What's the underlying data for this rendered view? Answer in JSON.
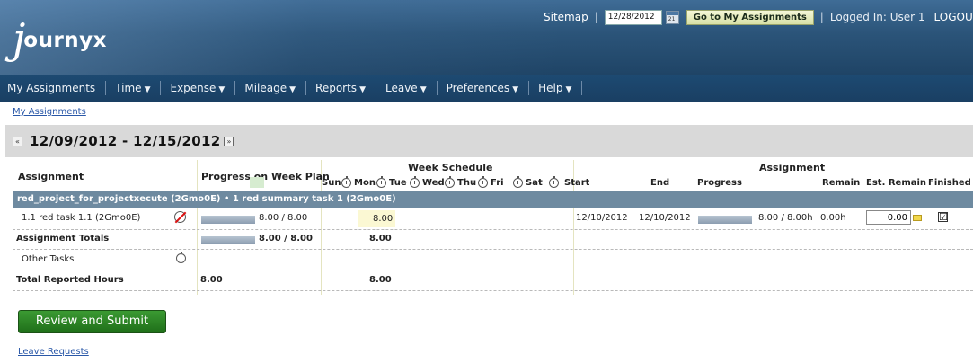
{
  "brand": {
    "logo_initial": "j",
    "logo_text": "ournyx"
  },
  "topbar": {
    "sitemap": "Sitemap",
    "date_value": "12/28/2012",
    "goto_label": "Go to My Assignments",
    "logged_in": "Logged In: User 1",
    "logout": "LOGOUT"
  },
  "nav": [
    {
      "label": "My Assignments",
      "arrow": ""
    },
    {
      "label": "Time",
      "arrow": "▼"
    },
    {
      "label": "Expense",
      "arrow": "▼"
    },
    {
      "label": "Mileage",
      "arrow": "▼"
    },
    {
      "label": "Reports",
      "arrow": "▼"
    },
    {
      "label": "Leave",
      "arrow": "▼"
    },
    {
      "label": "Preferences",
      "arrow": "▼"
    },
    {
      "label": "Help",
      "arrow": "▼"
    }
  ],
  "breadcrumb": "My Assignments",
  "week": {
    "prev": "«",
    "title": "12/09/2012 - 12/15/2012",
    "next": "»"
  },
  "table": {
    "headers": {
      "assignment": "Assignment",
      "progress_plan": "Progress on Week Plan",
      "week_schedule": "Week Schedule",
      "assignment_group": "Assignment",
      "days": [
        "Sun",
        "Mon",
        "Tue",
        "Wed",
        "Thu",
        "Fri",
        "Sat"
      ],
      "start": "Start",
      "end": "End",
      "progress": "Progress",
      "remain": "Remain",
      "est_remain": "Est. Remain",
      "finished": "Finished"
    },
    "project_row": "red_project_for_projectxecute (2Gmo0E) • 1 red summary task 1 (2Gmo0E)",
    "task_row": {
      "name": "1.1 red task 1.1 (2Gmo0E)",
      "plan_progress": 1.0,
      "plan_text": "8.00 / 8.00",
      "mon_hours": "8.00",
      "start": "12/10/2012",
      "end": "12/10/2012",
      "progress": 1.0,
      "progress_text": "8.00 / 8.00h",
      "remain": "0.00h",
      "est_remain": "0.00",
      "finished": "☑"
    },
    "totals_row": {
      "label": "Assignment Totals",
      "plan_progress": 1.0,
      "plan_text": "8.00 / 8.00",
      "hours": "8.00"
    },
    "other_row": {
      "label": "Other Tasks"
    },
    "reported_row": {
      "label": "Total Reported Hours",
      "plan": "8.00",
      "hours": "8.00"
    }
  },
  "review_button": "Review and Submit",
  "leave_link": "Leave Requests",
  "colors": {
    "header": "#2b5479",
    "nav": "#1d4a72",
    "project_row": "#6e8aa0",
    "button": "#2a8a26"
  }
}
